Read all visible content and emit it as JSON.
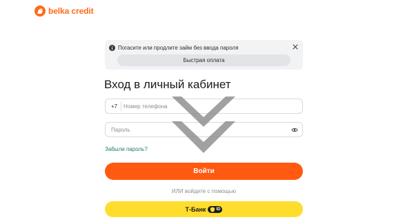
{
  "header": {
    "logo_text": "belka credit",
    "logo_icon": "squirrel-icon"
  },
  "notice": {
    "text": "Погасите или продлите займ без ввода пароля",
    "quick_pay_label": "Быстрая оплата",
    "info_icon": "info-icon",
    "close_icon": "close-icon"
  },
  "login": {
    "title": "Вход в личный кабинет",
    "phone_prefix": "+7",
    "phone_placeholder": "Номер телефона",
    "phone_value": "",
    "password_placeholder": "Пароль",
    "password_value": "",
    "forgot_label": "Забыли пароль?",
    "submit_label": "Войти",
    "alt_login_text": "ИЛИ войдите с помощью",
    "tbank_label": "Т-Банк",
    "tbank_badge": "ID"
  },
  "overlay": {
    "icon": "double-chevron-down-icon"
  },
  "colors": {
    "brand_orange": "#ff5a0f",
    "tbank_yellow": "#ffdd2d",
    "link_teal": "#1d7a6e",
    "overlay_gray": "#8c8c8c"
  }
}
